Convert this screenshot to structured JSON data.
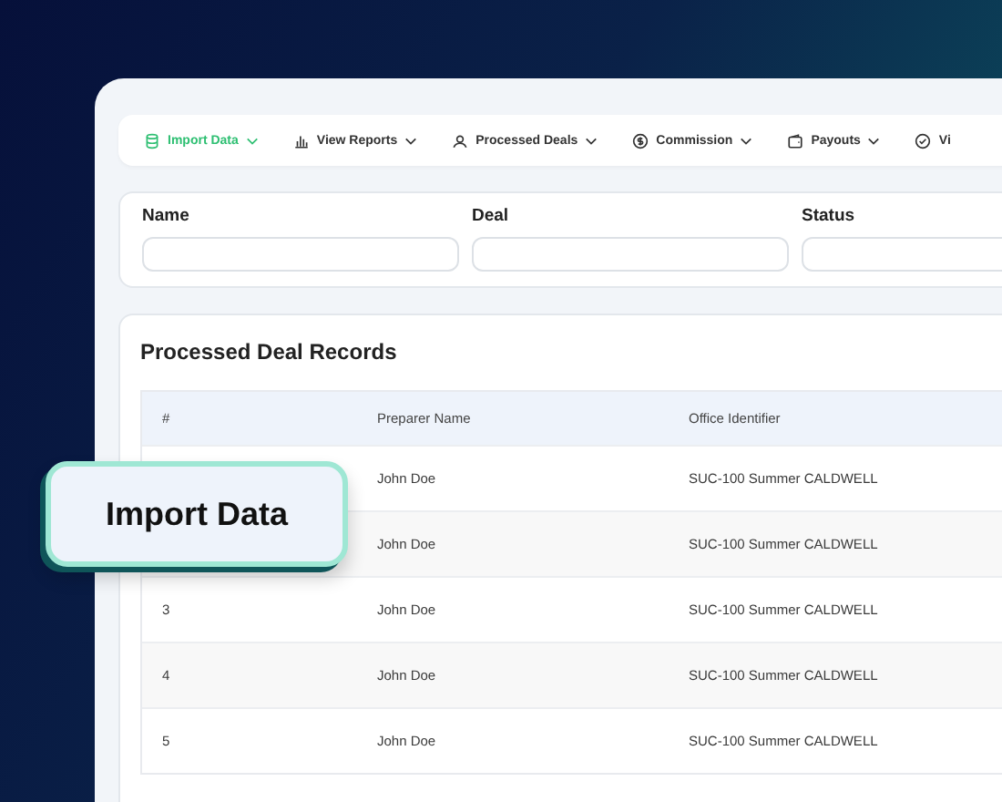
{
  "nav": [
    {
      "kind": "database",
      "label": "Import Data",
      "selected": true
    },
    {
      "kind": "chart",
      "label": "View Reports",
      "selected": false
    },
    {
      "kind": "users",
      "label": "Processed Deals",
      "selected": false
    },
    {
      "kind": "dollar",
      "label": "Commission",
      "selected": false
    },
    {
      "kind": "wallet",
      "label": "Payouts",
      "selected": false
    },
    {
      "kind": "check",
      "label": "Vi",
      "selected": false
    }
  ],
  "filters": [
    {
      "label": "Name"
    },
    {
      "label": "Deal"
    },
    {
      "label": "Status"
    }
  ],
  "table": {
    "title": "Processed Deal Records",
    "columns": [
      "#",
      "Preparer Name",
      "Office Identifier"
    ],
    "rows": [
      [
        "",
        "John Doe",
        "SUC-100 Summer CALDWELL"
      ],
      [
        "",
        "John Doe",
        "SUC-100 Summer CALDWELL"
      ],
      [
        "3",
        "John Doe",
        "SUC-100 Summer CALDWELL"
      ],
      [
        "4",
        "John Doe",
        "SUC-100 Summer CALDWELL"
      ],
      [
        "5",
        "John Doe",
        "SUC-100 Summer CALDWELL"
      ]
    ]
  },
  "callout": {
    "label": "Import Data"
  }
}
